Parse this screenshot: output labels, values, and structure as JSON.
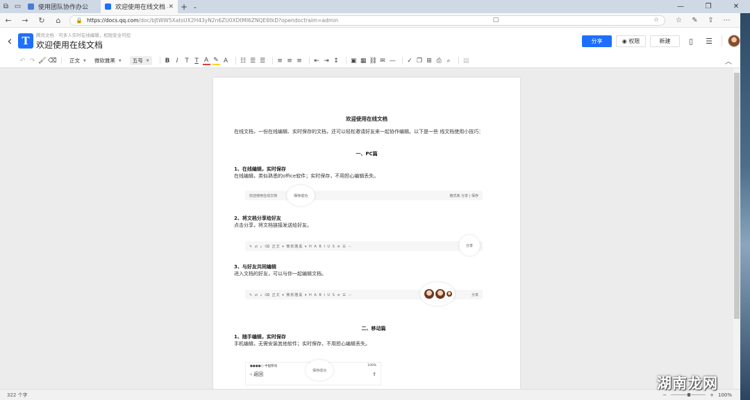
{
  "browser": {
    "tabs": [
      {
        "title": "使用团队协作办公",
        "active": false
      },
      {
        "title": "欢迎使用在线文档 - 腾讯",
        "active": true
      }
    ],
    "url_host": "https://docs.qq.com",
    "url_path": "/doc/bJtWW5XatsUX2H43yN2n6ZU0XDtMI6ZNQE6tkD?opendoctraim=admin"
  },
  "app": {
    "doc_subtitle": "腾讯文档 · 可多人实时在线编辑，权限安全可控",
    "doc_title": "欢迎使用在线文档",
    "share_label": "分享",
    "perm_label": "权限",
    "new_label": "新建",
    "accent": "#1e6fff"
  },
  "toolbar": {
    "style": "正文",
    "font": "微软雅黑",
    "size": "五号"
  },
  "doc": {
    "title": "欢迎使用在线文档",
    "intro": "在线文档，一份在线编辑、实时保存的文档，还可以轻松邀请好友来一起协作编辑。以下是一些 线文档使用小技巧：",
    "pc_heading": "一、PC篇",
    "s1_h": "1、在线编辑，实时保存",
    "s1_t": "在线编辑，类似熟悉的office软件；实时保存，不用担心编辑丢失。",
    "s1_mock_left": "欢迎使用在线文档",
    "s1_mock_bubble": "保存成功",
    "s1_mock_right": "格式库   分享 | 保存",
    "s2_h": "2、将文档分享给好友",
    "s2_t": "点击分享，将文档链接发送给好友。",
    "s2_bubble": "分享",
    "s3_h": "3、与好友共同编辑",
    "s3_t": "进入文档的好友，可以与你一起编辑文档。",
    "s3_share": "分享",
    "mobile_heading": "二、移动篇",
    "m1_h": "1、随手编辑，实时保存",
    "m1_t": "手机编辑，无需安装其他软件；实时保存，不用担心编辑丢失。",
    "phone_carrier": "●●●●○ 中国移动",
    "phone_batt": "100%",
    "phone_back": "返回",
    "phone_bubble": "保存成功",
    "mock_tools": "✎ ⇄ ⤶ ⌫  正文 ▾  微软雅黑 ▾  H  A  B  I  U  S  ≡  ☰  ⋯"
  },
  "status": {
    "word_count": "322 个字",
    "zoom": "100%"
  },
  "watermark": "湖南龙网"
}
